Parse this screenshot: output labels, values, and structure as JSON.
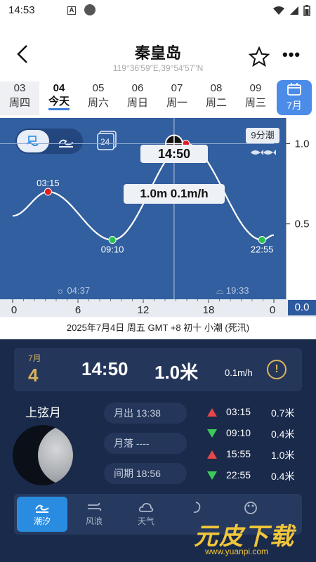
{
  "status": {
    "time": "14:53",
    "a_icon": "A"
  },
  "header": {
    "title": "秦皇岛",
    "coords": "119°36′59″E,39°54′57″N",
    "more": "•••"
  },
  "dates": [
    {
      "d": "03",
      "w": "周四"
    },
    {
      "d": "04",
      "w": "今天"
    },
    {
      "d": "05",
      "w": "周六"
    },
    {
      "d": "06",
      "w": "周日"
    },
    {
      "d": "07",
      "w": "周一"
    },
    {
      "d": "08",
      "w": "周二"
    },
    {
      "d": "09",
      "w": "周三"
    }
  ],
  "calendar": {
    "label": "7月"
  },
  "chart": {
    "badge": "9分潮",
    "icon24": "24",
    "cursor_time": "14:50",
    "cursor_value": "1.0m  0.1m/h",
    "sunrise": "04:37",
    "sunset": "19:33",
    "x_ticks": [
      "0",
      "6",
      "12",
      "18",
      "0"
    ],
    "y_ticks": [
      "1.0",
      "0.5"
    ],
    "y_axis_value": "0.0",
    "points": [
      {
        "label": "03:15"
      },
      {
        "label": "09:10"
      },
      {
        "label": "22:55"
      }
    ]
  },
  "chart_data": {
    "type": "line",
    "xlabel": "",
    "ylabel": "",
    "xlim": [
      0,
      24
    ],
    "ylim": [
      0.0,
      1.2
    ],
    "x_ticks": [
      0,
      6,
      12,
      18,
      24
    ],
    "y_ticks": [
      0.5,
      1.0
    ],
    "series": [
      {
        "x": [
          0,
          3.25,
          9.17,
          15.92,
          22.92,
          24
        ],
        "values": [
          0.55,
          0.7,
          0.4,
          1.0,
          0.4,
          0.43
        ]
      }
    ],
    "extrema": [
      {
        "time": "03:15",
        "value": 0.7,
        "kind": "high"
      },
      {
        "time": "09:10",
        "value": 0.4,
        "kind": "low"
      },
      {
        "time": "15:55",
        "value": 1.0,
        "kind": "high"
      },
      {
        "time": "22:55",
        "value": 0.4,
        "kind": "low"
      }
    ],
    "cursor": {
      "time": "14:50",
      "value": 1.0
    },
    "colors": {
      "high": "#e01e1e",
      "low": "#27c24c",
      "line": "#ffffff",
      "background": "#315f9f"
    }
  },
  "info_line": "2025年7月4日 周五 GMT +8 初十 小潮 (死汛)",
  "card": {
    "month": "7月",
    "day": "4",
    "time": "14:50",
    "height": "1.0米",
    "speed": "0.1m/h",
    "warn": "!"
  },
  "moon": {
    "phase": "上弦月"
  },
  "pills": {
    "rise": "月出 13:38",
    "set": "月落 ----",
    "period": "间期 18:56"
  },
  "tides": [
    {
      "time": "03:15",
      "height": "0.7米",
      "dir": "up"
    },
    {
      "time": "09:10",
      "height": "0.4米",
      "dir": "down"
    },
    {
      "time": "15:55",
      "height": "1.0米",
      "dir": "up"
    },
    {
      "time": "22:55",
      "height": "0.4米",
      "dir": "down"
    }
  ],
  "nav": [
    {
      "label": "潮汐",
      "icon": "wave-icon"
    },
    {
      "label": "风浪",
      "icon": "wind-icon"
    },
    {
      "label": "天气",
      "icon": "cloud-icon"
    }
  ],
  "watermark": {
    "main": "元皮下载",
    "url": "www.yuanpi.com"
  }
}
